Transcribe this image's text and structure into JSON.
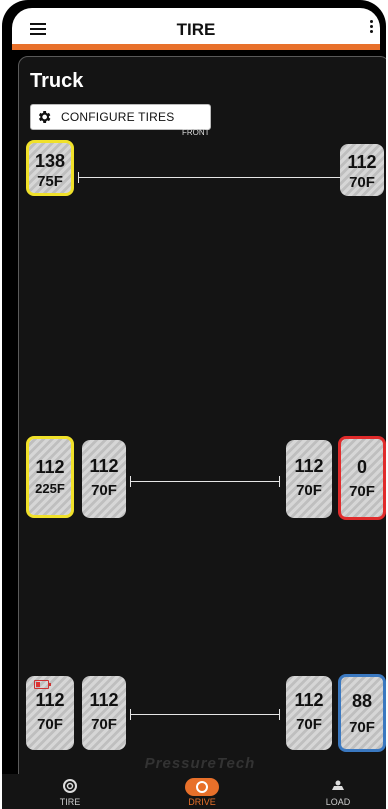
{
  "header": {
    "title": "TIRE"
  },
  "vehicle": {
    "name": "Truck",
    "configure_label": "CONFIGURE TIRES",
    "front_label": "FRONT"
  },
  "axles": [
    {
      "tires": [
        {
          "pressure": "138",
          "temp": "75F",
          "alert": "yellow"
        },
        {
          "pressure": "112",
          "temp": "70F",
          "alert": "none"
        }
      ]
    },
    {
      "tires": [
        {
          "pressure": "112",
          "temp": "225F",
          "alert": "yellow"
        },
        {
          "pressure": "112",
          "temp": "70F",
          "alert": "none"
        },
        {
          "pressure": "112",
          "temp": "70F",
          "alert": "none"
        },
        {
          "pressure": "0",
          "temp": "70F",
          "alert": "red"
        }
      ]
    },
    {
      "tires": [
        {
          "pressure": "112",
          "temp": "70F",
          "alert": "low-battery"
        },
        {
          "pressure": "112",
          "temp": "70F",
          "alert": "none"
        },
        {
          "pressure": "112",
          "temp": "70F",
          "alert": "none"
        },
        {
          "pressure": "88",
          "temp": "70F",
          "alert": "blue"
        }
      ]
    }
  ],
  "watermark": "PressureTech",
  "nav": {
    "tire": "TIRE",
    "drive": "DRIVE",
    "load": "LOAD",
    "active": "drive"
  },
  "colors": {
    "accent": "#e8702a",
    "alert_yellow": "#f0e12a",
    "alert_red": "#e02b2b",
    "alert_blue": "#3a78c0"
  }
}
